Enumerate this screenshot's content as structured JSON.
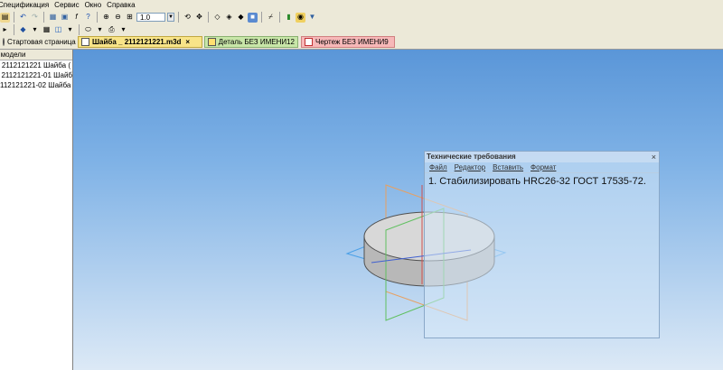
{
  "menu": [
    "Спецификация",
    "Сервис",
    "Окно",
    "Справка"
  ],
  "toolbar": {
    "zoom_value": "1.0",
    "icons": [
      "new-icon",
      "save-icon",
      "undo-icon",
      "redo-icon",
      "library-icon",
      "fx-icon",
      "help-icon",
      "zoom-in-icon",
      "zoom-out-icon",
      "zoom-fit-icon",
      "rotate-icon",
      "pan-icon",
      "view-iso-icon",
      "wireframe-icon",
      "shaded-icon",
      "section-icon",
      "measure-icon",
      "properties-icon"
    ]
  },
  "tabs": {
    "start_label": "Стартовая страница",
    "washer_label": "Шайба _ 2112121221.m3d",
    "washer_close": "×",
    "detail_label": "Деталь БЕЗ ИМЕНИ12",
    "drawing_label": "Чертеж БЕЗ ИМЕНИ9"
  },
  "tree": {
    "header": "о модели",
    "items": [
      "2112121221 Шайба (",
      "2112121221-01 Шайб",
      "112121221-02 Шайба"
    ]
  },
  "tech_window": {
    "title": "Технические требования",
    "close": "×",
    "menu": [
      "Файл",
      "Редактор",
      "Вставить",
      "Формат"
    ],
    "line1": "1.  Стабилизировать HRC26-32 ГОСТ 17535-72."
  },
  "colors": {
    "viewport_top": "#5a96d8",
    "viewport_bottom": "#dce9f6",
    "washer_tab": "#f8e488",
    "detail_tab": "#c8e6a8",
    "drawing_tab": "#f7b8b8"
  }
}
